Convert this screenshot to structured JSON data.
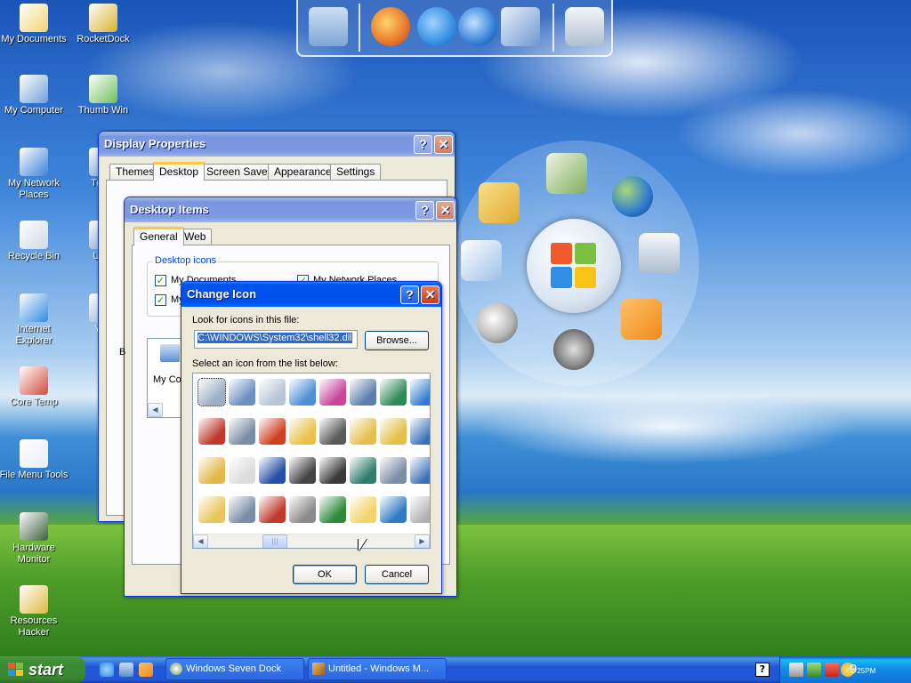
{
  "desktop": {
    "icons": [
      {
        "label": "My Documents",
        "icon": "folder-documents-icon",
        "color": "#f4d46a"
      },
      {
        "label": "RocketDock",
        "icon": "rocketdock-icon",
        "color": "#d9b12c"
      },
      {
        "label": "My Computer",
        "icon": "computer-icon",
        "color": "#6fa0d8"
      },
      {
        "label": "Thumb Win",
        "icon": "thumbnail-icon",
        "color": "#6dbf5a"
      },
      {
        "label": "My Network Places",
        "icon": "network-icon",
        "color": "#3d82d6"
      },
      {
        "label": "Trans",
        "icon": "transparency-icon",
        "color": "#5a86c9"
      },
      {
        "label": "Recycle Bin",
        "icon": "recycle-bin-icon",
        "color": "#cfd9e4"
      },
      {
        "label": "Ultra",
        "icon": "ultra-icon",
        "color": "#6e8fc4"
      },
      {
        "label": "Internet Explorer",
        "icon": "internet-explorer-icon",
        "color": "#2f8be0"
      },
      {
        "label": "YzS",
        "icon": "yzshadow-icon",
        "color": "#8aa7cf"
      },
      {
        "label": "Core Temp",
        "icon": "thermometer-icon",
        "color": "#d14a3c"
      },
      {
        "label": "File Menu Tools",
        "icon": "file-menu-tools-icon",
        "color": "#e6eef8"
      },
      {
        "label": "Hardware Monitor",
        "icon": "hardware-monitor-icon",
        "color": "#3c5d3c"
      },
      {
        "label": "Resources Hacker",
        "icon": "resource-hacker-icon",
        "color": "#e0b83a"
      }
    ]
  },
  "topdock": {
    "items": [
      {
        "icon": "monitor-icon",
        "color": "#8fb2dc"
      },
      {
        "icon": "firefox-icon",
        "color": "#e8772b"
      },
      {
        "icon": "internet-explorer-icon",
        "color": "#2f8be0"
      },
      {
        "icon": "media-player-icon",
        "color": "#2c7ad6"
      },
      {
        "icon": "control-panel-icon",
        "color": "#6f96d1"
      },
      {
        "icon": "recycle-bin-icon",
        "color": "#d7e2ec"
      }
    ]
  },
  "circledock": {
    "items": [
      {
        "icon": "folder-open-icon",
        "color": "#f1c95a"
      },
      {
        "icon": "documents-stack-icon",
        "color": "#7fae5f"
      },
      {
        "icon": "globe-icon",
        "color": "#2f7bd1"
      },
      {
        "icon": "control-panel-icon",
        "color": "#9dc0e6"
      },
      {
        "icon": "recycle-bin-icon",
        "color": "#cdd9e6"
      },
      {
        "icon": "magnifier-icon",
        "color": "#b8b8b8"
      },
      {
        "icon": "film-reel-icon",
        "color": "#8a8a8a"
      },
      {
        "icon": "media-player-icon",
        "color": "#f08a1a"
      }
    ]
  },
  "display_properties": {
    "title": "Display Properties",
    "tabs": [
      "Themes",
      "Desktop",
      "Screen Saver",
      "Appearance",
      "Settings"
    ]
  },
  "desktop_items": {
    "title": "Desktop Items",
    "tabs": [
      "General",
      "Web"
    ],
    "group_title": "Desktop icons",
    "checkbox_1": "My Documents",
    "checkbox_2": "My Network Places",
    "checkbox_3": "My",
    "preview_label": "My Co",
    "side_label": "B"
  },
  "change_icon": {
    "title": "Change Icon",
    "look_label": "Look for icons in this file:",
    "file_path": "C:\\WINDOWS\\System32\\shell32.dll",
    "browse_label": "Browse...",
    "select_label": "Select an icon from the list below:",
    "ok_label": "OK",
    "cancel_label": "Cancel",
    "icon_rows": [
      [
        "recycle-bin-icon",
        "computer-network-icon",
        "gear-document-icon",
        "network-card-icon",
        "color-palette-icon",
        "tree-diagram-icon",
        "globe-network-icon",
        "globe-icon"
      ],
      [
        "delete-document-icon",
        "gear-icon",
        "font-icon",
        "warning-folder-icon",
        "printer-check-icon",
        "folder-network-icon",
        "folder-share-icon",
        "monitor-icon"
      ],
      [
        "folder-move-icon",
        "text-document-icon",
        "truetype-font-icon",
        "drive-icon",
        "printer-network-icon",
        "star-book-icon",
        "gear-window-icon",
        "monitor-icon"
      ],
      [
        "folder-icon",
        "gear-icon",
        "font-a-icon",
        "search-computer-icon",
        "printer-disk-icon",
        "new-folder-icon",
        "globe-icon",
        "document-icon"
      ]
    ],
    "icon_colors": [
      "#9bb0c4",
      "#6b8fc0",
      "#b9c6d6",
      "#4f8fd6",
      "#c8459a",
      "#5d7fae",
      "#2e8b57",
      "#2f7bd1",
      "#c0392b",
      "#7a8da6",
      "#d04020",
      "#e8c24a",
      "#5a5a5a",
      "#e3c04c",
      "#e3c04c",
      "#3b6fb8",
      "#e2b84a",
      "#dcdcdc",
      "#2850a8",
      "#444444",
      "#3a3a3a",
      "#2f7d6a",
      "#7a8da6",
      "#3b6fb8",
      "#e9c55a",
      "#7a8da6",
      "#c0392b",
      "#8a8a8a",
      "#2d8a3a",
      "#f3d46a",
      "#2e7bc4",
      "#b0b0b0"
    ]
  },
  "taskbar": {
    "start_label": "start",
    "tasks": [
      {
        "label": "Windows Seven Dock",
        "icon": "dock-icon"
      },
      {
        "label": "Untitled - Windows M...",
        "icon": "movie-maker-icon"
      }
    ],
    "clock_hour": "9",
    "clock_minute": "25",
    "clock_ampm": "PM",
    "help_label": "?"
  }
}
